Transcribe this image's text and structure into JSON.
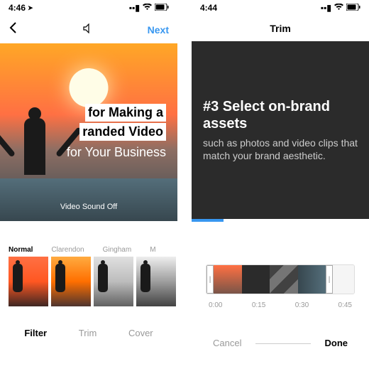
{
  "left": {
    "status": {
      "time": "4:46",
      "locArrow": "➤"
    },
    "nav": {
      "sound": "",
      "next": "Next"
    },
    "overlay": {
      "line1": "for Making a",
      "line2": "randed Video",
      "line3": "for Your Business"
    },
    "soundToast": "Video Sound Off",
    "filters": [
      "Normal",
      "Clarendon",
      "Gingham",
      "M"
    ],
    "tabs": [
      "Filter",
      "Trim",
      "Cover"
    ]
  },
  "right": {
    "status": {
      "time": "4:44"
    },
    "nav": {
      "title": "Trim"
    },
    "slide": {
      "heading": "#3 Select on-brand assets",
      "body": "such as photos and video clips that match your brand aesthetic."
    },
    "timestamps": [
      "0:00",
      "0:15",
      "0:30",
      "0:45"
    ],
    "actions": {
      "cancel": "Cancel",
      "done": "Done"
    }
  }
}
